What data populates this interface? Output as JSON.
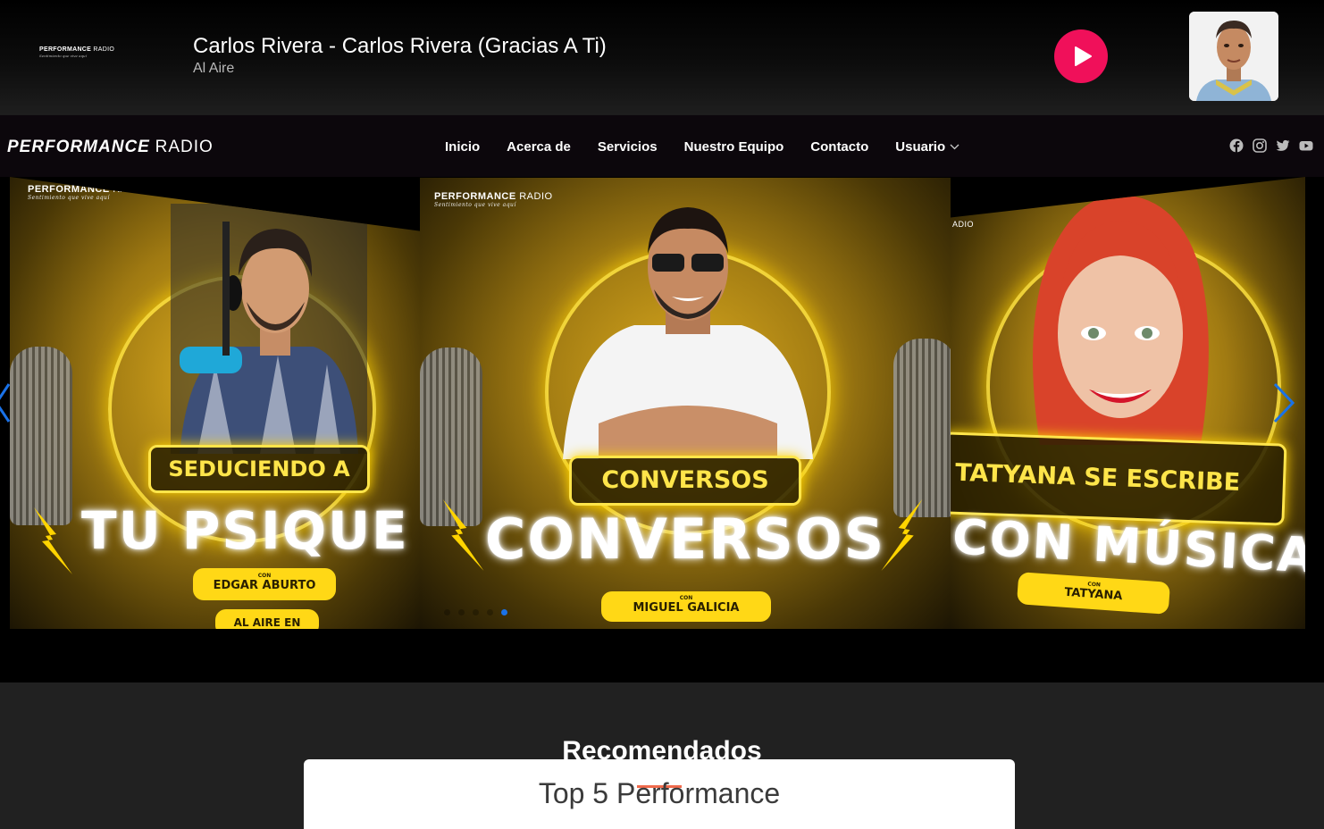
{
  "player": {
    "logo_brand_bold": "PERFORMANCE",
    "logo_brand_light": "RADIO",
    "logo_tagline": "Sentimiento que vive aquí",
    "track_title": "Carlos Rivera - Carlos Rivera (Gracias A Ti)",
    "status": "Al Aire",
    "play_color": "#f0105a"
  },
  "nav": {
    "brand_bold": "PERFORMANCE",
    "brand_light": "RADIO",
    "items": [
      "Inicio",
      "Acerca de",
      "Servicios",
      "Nuestro Equipo",
      "Contacto",
      "Usuario"
    ],
    "social": [
      "facebook-icon",
      "instagram-icon",
      "twitter-icon",
      "youtube-icon"
    ]
  },
  "slider": {
    "slides": [
      {
        "brand_bold": "PERFORMANCE",
        "brand_light": "RADIO",
        "tagline": "Sentimiento que vive aquí",
        "pill": "SEDUCIENDO A",
        "big": "TU PSIQUE",
        "host_con": "CON",
        "host": "EDGAR ABURTO",
        "extra": "AL AIRE EN"
      },
      {
        "brand_bold": "PERFORMANCE",
        "brand_light": "RADIO",
        "tagline": "Sentimiento que vive aquí",
        "pill": "CONVERSOS",
        "big": "CONVERSOS",
        "host_con": "CON",
        "host": "MIGUEL GALICIA"
      },
      {
        "brand_light": "ADIO",
        "pill": "TATYANA SE ESCRIBE",
        "big": "CON MÚSICA",
        "host_con": "CON",
        "host": "TATYANA"
      }
    ],
    "dots_total": 5,
    "dots_active": 5,
    "accent": "#ffe54a"
  },
  "section": {
    "title": "Recomendados",
    "card_title": "Top 5 Performance",
    "underline_color": "#f06a4c"
  }
}
